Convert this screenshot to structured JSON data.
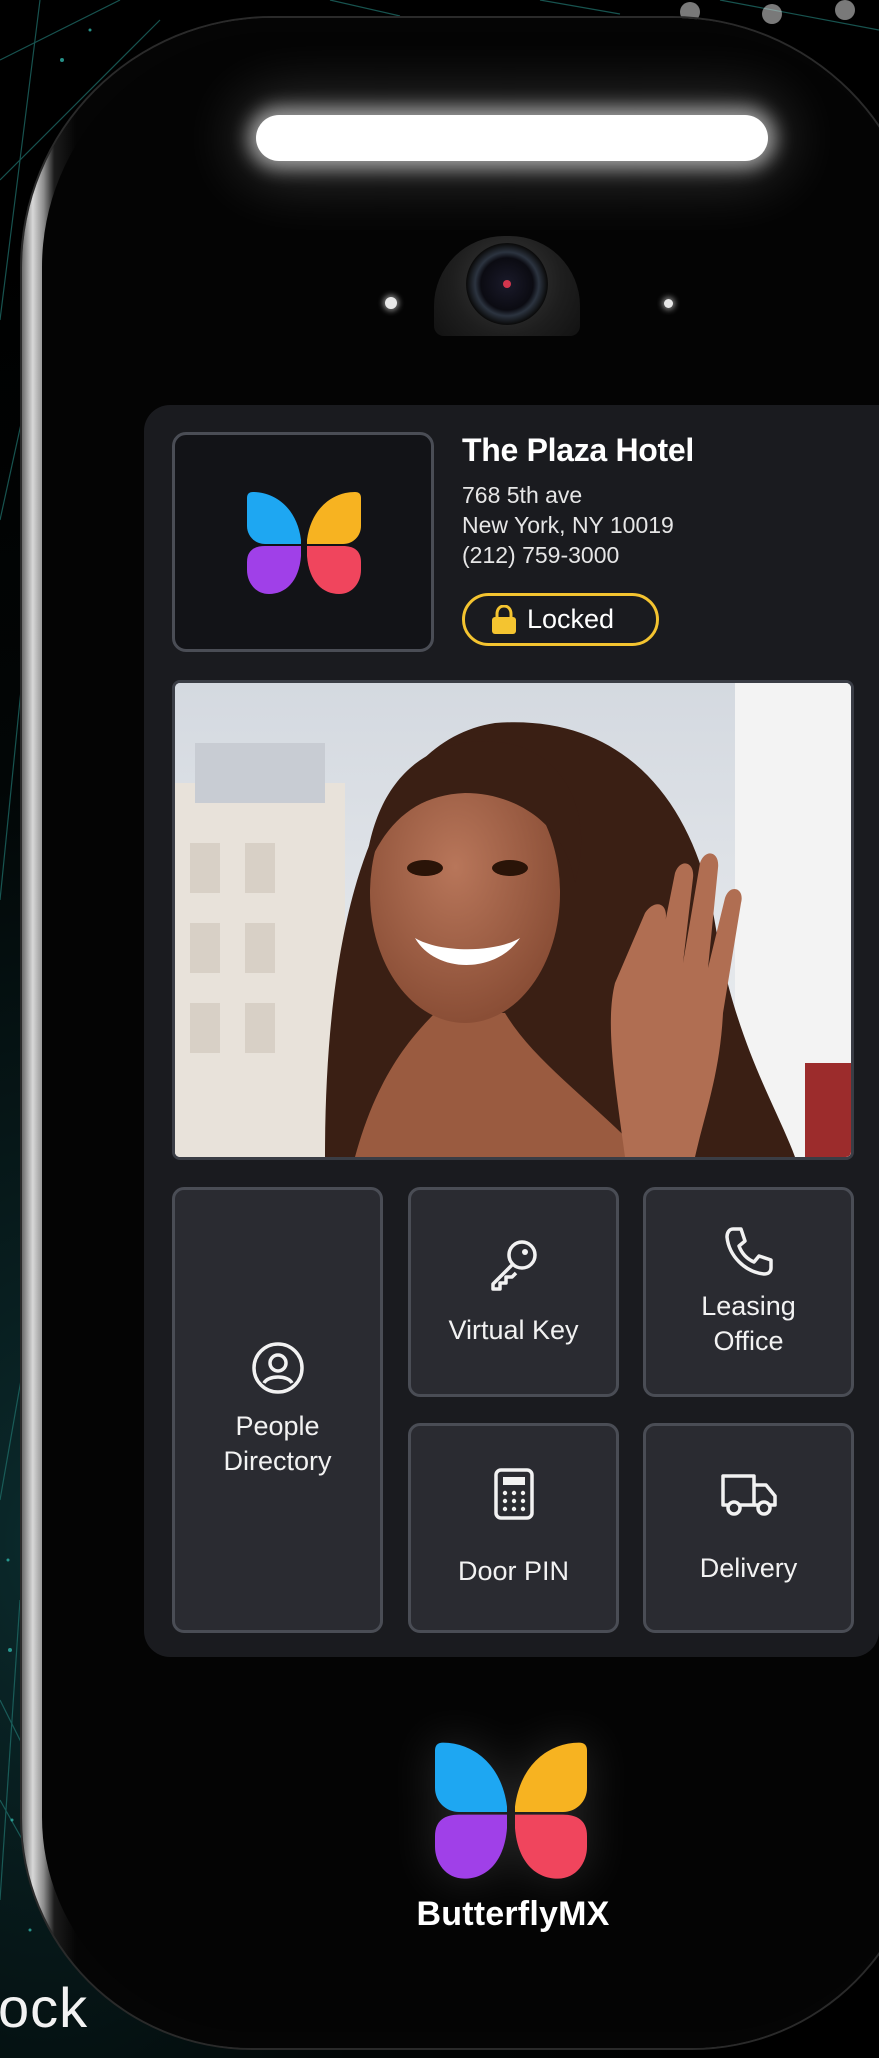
{
  "building": {
    "name": "The Plaza Hotel",
    "address_line1": "768 5th ave",
    "address_line2": "New York, NY 10019",
    "phone": "(212) 759-3000"
  },
  "lock_status": {
    "label": "Locked",
    "color": "#f4c430",
    "icon": "padlock-icon"
  },
  "visitor_video": {
    "description_icon": "visitor-photo"
  },
  "actions": [
    {
      "label": "People\nDirectory",
      "icon": "user-circle-icon"
    },
    {
      "label": "Virtual Key",
      "icon": "key-icon"
    },
    {
      "label": "Leasing\nOffice",
      "icon": "phone-icon"
    },
    {
      "label": "Door PIN",
      "icon": "keypad-icon"
    },
    {
      "label": "Delivery",
      "icon": "truck-icon"
    }
  ],
  "brand": {
    "name": "ButterflyMX",
    "logo_colors": [
      "#1ea7f2",
      "#f7b321",
      "#a040e8",
      "#f0455d"
    ]
  },
  "background_text": "ock"
}
